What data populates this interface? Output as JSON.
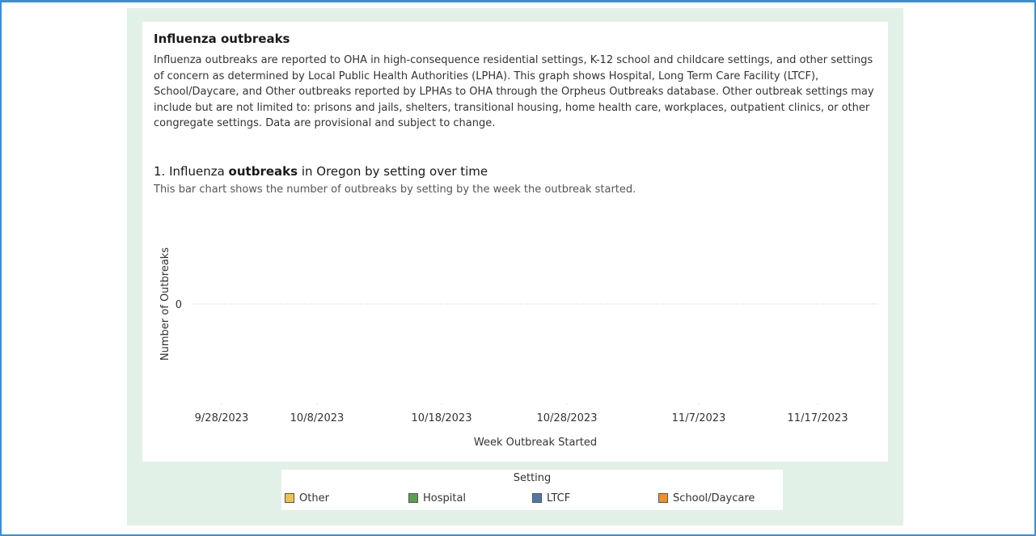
{
  "intro": {
    "title": "Influenza outbreaks",
    "body": "Influenza outbreaks are reported to OHA in high-consequence residential settings, K-12 school and childcare settings, and other settings of concern as determined by Local Public Health Authorities (LPHA). This graph shows Hospital, Long Term Care Facility (LTCF), School/Daycare, and Other outbreaks reported by LPHAs to OHA through the Orpheus Outbreaks database. Other outbreak settings may include but are not limited to: prisons and jails, shelters, transitional housing, home health care, workplaces, outpatient clinics, or other congregate settings. Data are provisional and subject to change."
  },
  "chart_header": {
    "title_part1": "1. Influenza ",
    "title_part2": "outbreaks",
    "title_part3": " in Oregon by setting over time",
    "subtitle": "This bar chart shows the number of outbreaks by setting by the week the outbreak started."
  },
  "chart_data": {
    "type": "bar",
    "title": "1. Influenza outbreaks in Oregon by setting over time",
    "xlabel": "Week Outbreak Started",
    "ylabel": "Number of Outbreaks",
    "x_ticks": [
      "9/28/2023",
      "10/8/2023",
      "10/18/2023",
      "10/28/2023",
      "11/7/2023",
      "11/17/2023"
    ],
    "y_ticks": [
      0
    ],
    "series": [
      {
        "name": "Other",
        "color": "#f2c14e",
        "values": []
      },
      {
        "name": "Hospital",
        "color": "#59a14f",
        "values": []
      },
      {
        "name": "LTCF",
        "color": "#4e79a7",
        "values": []
      },
      {
        "name": "School/Daycare",
        "color": "#f28e2b",
        "values": []
      }
    ],
    "grid": "zero line dotted",
    "legend_title": "Setting",
    "legend_position": "bottom-center"
  }
}
